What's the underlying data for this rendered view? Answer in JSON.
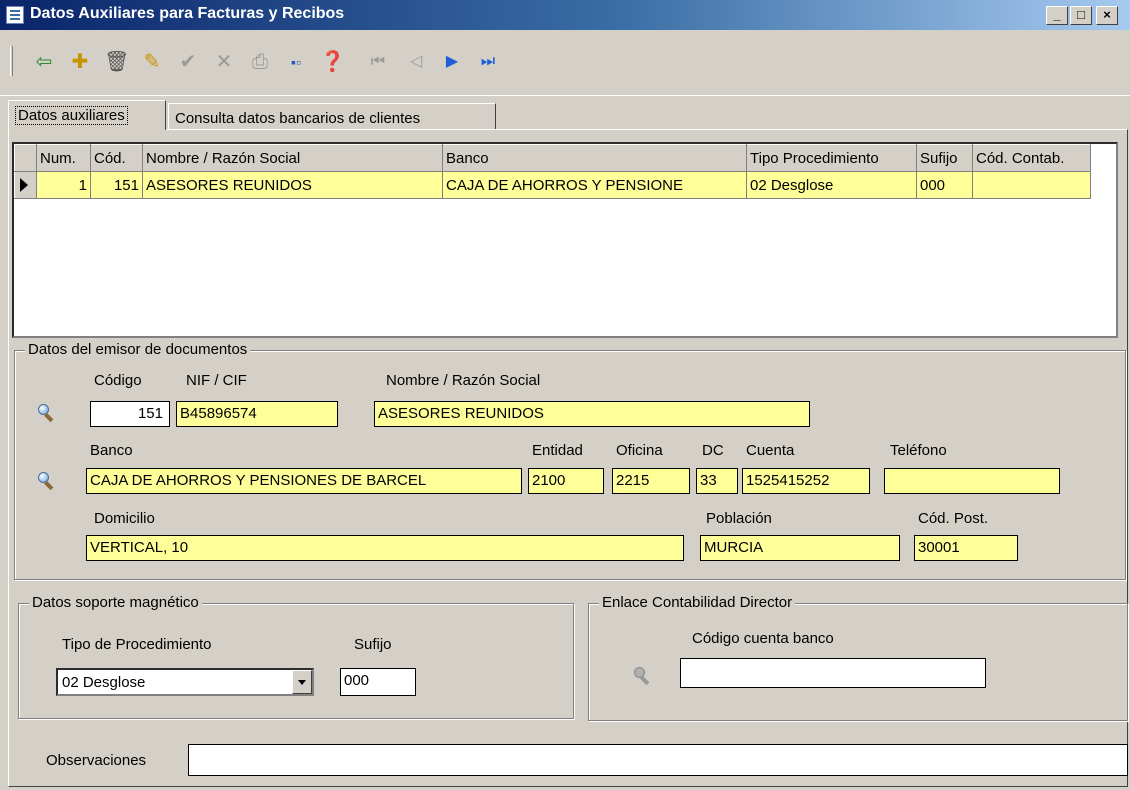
{
  "window": {
    "title": "Datos Auxiliares para Facturas y Recibos"
  },
  "toolbar": {
    "buttons": [
      "exit-icon",
      "new-record-icon",
      "delete-icon",
      "edit-icon",
      "accept-icon",
      "cancel-icon",
      "print-icon",
      "view-icon",
      "help-icon",
      "first-record-icon",
      "prev-record-icon",
      "next-record-icon",
      "last-record-icon"
    ]
  },
  "tabs": [
    "Datos auxiliares",
    "Consulta datos bancarios de clientes"
  ],
  "grid": {
    "headers": [
      "Num.",
      "Cód.",
      "Nombre / Razón Social",
      "Banco",
      "Tipo Procedimiento",
      "Sufijo",
      "Cód. Contab."
    ],
    "rows": [
      {
        "num": "1",
        "cod": "151",
        "nombre": "ASESORES REUNIDOS",
        "banco": "CAJA DE AHORROS Y PENSIONE",
        "tipo": "02 Desglose",
        "sufijo": "000",
        "contab": ""
      }
    ]
  },
  "emisor": {
    "legend": "Datos del emisor de documentos",
    "labels": {
      "codigo": "Código",
      "nif": "NIF / CIF",
      "nombre": "Nombre / Razón Social",
      "banco": "Banco",
      "entidad": "Entidad",
      "oficina": "Oficina",
      "dc": "DC",
      "cuenta": "Cuenta",
      "telefono": "Teléfono",
      "domicilio": "Domicilio",
      "poblacion": "Población",
      "cp": "Cód. Post."
    },
    "values": {
      "codigo": "151",
      "nif": "B45896574",
      "nombre": "ASESORES REUNIDOS",
      "banco": "CAJA DE AHORROS Y PENSIONES DE BARCEL",
      "entidad": "2100",
      "oficina": "2215",
      "dc": "33",
      "cuenta": "1525415252",
      "telefono": "",
      "domicilio": "VERTICAL, 10",
      "poblacion": "MURCIA",
      "cp": "30001"
    }
  },
  "soporte": {
    "legend": "Datos soporte magnético",
    "tipo_label": "Tipo de Procedimiento",
    "tipo_value": "02 Desglose",
    "sufijo_label": "Sufijo",
    "sufijo_value": "000"
  },
  "enlace": {
    "legend": "Enlace Contabilidad Director",
    "cuenta_label": "Código cuenta banco",
    "cuenta_value": ""
  },
  "observaciones": {
    "label": "Observaciones",
    "value": ""
  }
}
